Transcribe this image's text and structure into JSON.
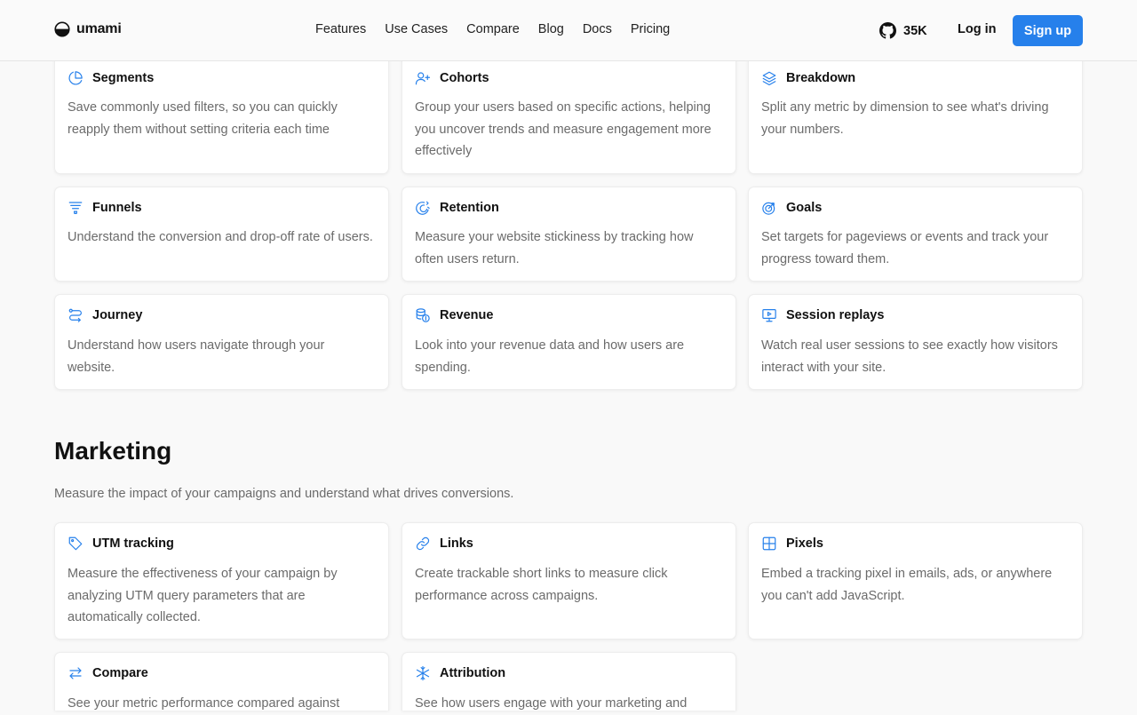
{
  "header": {
    "logo_text": "umami",
    "nav": [
      "Features",
      "Use Cases",
      "Compare",
      "Blog",
      "Docs",
      "Pricing"
    ],
    "github_stars": "35K",
    "login_label": "Log in",
    "signup_label": "Sign up"
  },
  "colors": {
    "accent": "#2680eb",
    "text": "#111111",
    "muted": "#6b6b6b",
    "page_bg": "#f9f9f9"
  },
  "analytics_cards": [
    {
      "icon": "pie-chart-icon",
      "title": "Segments",
      "desc": "Save commonly used filters, so you can quickly reapply them without setting criteria each time"
    },
    {
      "icon": "user-plus-icon",
      "title": "Cohorts",
      "desc": "Group your users based on specific actions, helping you uncover trends and measure engagement more effectively"
    },
    {
      "icon": "layers-icon",
      "title": "Breakdown",
      "desc": "Split any metric by dimension to see what's driving your numbers."
    },
    {
      "icon": "funnel-icon",
      "title": "Funnels",
      "desc": "Understand the conversion and drop-off rate of users."
    },
    {
      "icon": "magnet-icon",
      "title": "Retention",
      "desc": "Measure your website stickiness by tracking how often users return."
    },
    {
      "icon": "target-icon",
      "title": "Goals",
      "desc": "Set targets for pageviews or events and track your progress toward them."
    },
    {
      "icon": "route-icon",
      "title": "Journey",
      "desc": "Understand how users navigate through your website."
    },
    {
      "icon": "coins-icon",
      "title": "Revenue",
      "desc": "Look into your revenue data and how users are spending."
    },
    {
      "icon": "monitor-play-icon",
      "title": "Session replays",
      "desc": "Watch real user sessions to see exactly how visitors interact with your site."
    }
  ],
  "marketing": {
    "title": "Marketing",
    "subtitle": "Measure the impact of your campaigns and understand what drives conversions.",
    "cards": [
      {
        "icon": "tag-icon",
        "title": "UTM tracking",
        "desc": "Measure the effectiveness of your campaign by analyzing UTM query parameters that are automatically collected."
      },
      {
        "icon": "link-icon",
        "title": "Links",
        "desc": "Create trackable short links to measure click performance across campaigns."
      },
      {
        "icon": "grid-icon",
        "title": "Pixels",
        "desc": "Embed a tracking pixel in emails, ads, or anywhere you can't add JavaScript."
      },
      {
        "icon": "arrows-left-right-icon",
        "title": "Compare",
        "desc": "See your metric performance compared against"
      },
      {
        "icon": "snowflake-icon",
        "title": "Attribution",
        "desc": "See how users engage with your marketing and"
      }
    ]
  }
}
